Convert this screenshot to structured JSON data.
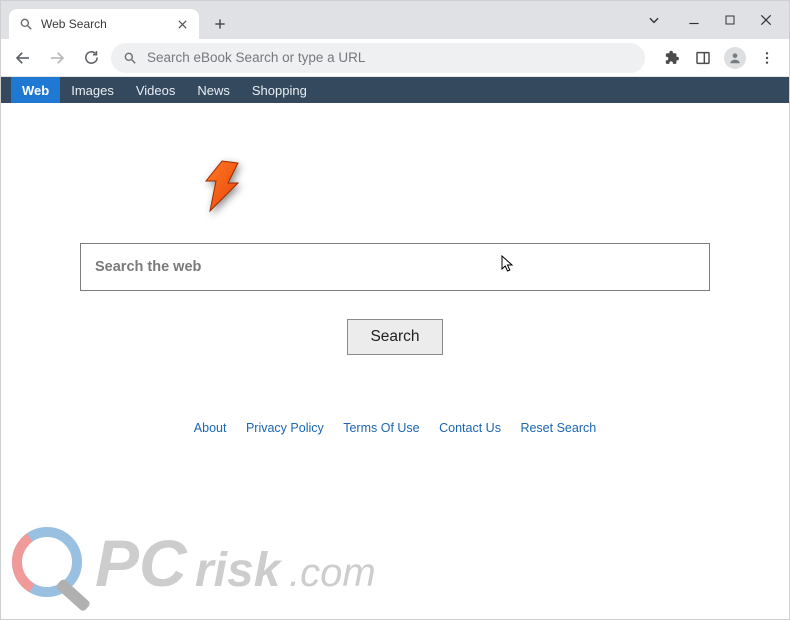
{
  "browser": {
    "tab_title": "Web Search",
    "omnibox_placeholder": "Search eBook Search or type a URL"
  },
  "page": {
    "tabs": [
      {
        "label": "Web",
        "active": true
      },
      {
        "label": "Images",
        "active": false
      },
      {
        "label": "Videos",
        "active": false
      },
      {
        "label": "News",
        "active": false
      },
      {
        "label": "Shopping",
        "active": false
      }
    ],
    "search_placeholder": "Search the web",
    "search_button": "Search",
    "footer": [
      "About",
      "Privacy Policy",
      "Terms Of Use",
      "Contact Us",
      "Reset Search"
    ]
  },
  "watermark": {
    "text": "PCrisk.com"
  },
  "icons": {
    "favicon": "magnifier",
    "close": "x",
    "newtab": "plus"
  }
}
